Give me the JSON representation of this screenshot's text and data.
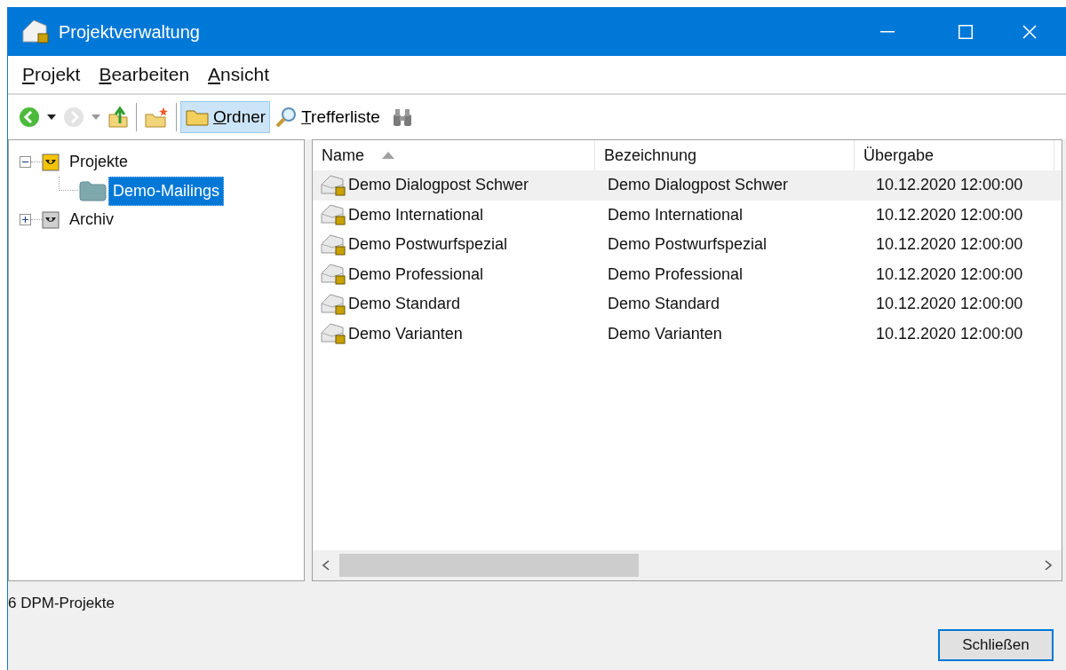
{
  "window": {
    "title": "Projektverwaltung"
  },
  "menu": [
    {
      "label": "Projekt",
      "mnemonic": true
    },
    {
      "label": "Bearbeiten",
      "mnemonic": true
    },
    {
      "label": "Ansicht",
      "mnemonic": true
    }
  ],
  "toolbar": [
    {
      "kind": "back",
      "disabled": false
    },
    {
      "kind": "back-dropdown",
      "disabled": false
    },
    {
      "kind": "forward",
      "disabled": true
    },
    {
      "kind": "forward-dropdown",
      "disabled": true
    },
    {
      "kind": "up",
      "disabled": false
    },
    {
      "kind": "separator"
    },
    {
      "kind": "new-folder",
      "disabled": false
    },
    {
      "kind": "separator"
    },
    {
      "kind": "folders",
      "label": "Ordner",
      "mnemonic": true,
      "selected": true
    },
    {
      "kind": "results",
      "label": "Trefferliste",
      "mnemonic": true,
      "selected": false
    },
    {
      "kind": "find",
      "disabled": false
    }
  ],
  "tree": [
    {
      "label": "Projekte",
      "expanded": true,
      "selected": false,
      "active": true,
      "children": [
        {
          "label": "Demo-Mailings",
          "selected": true
        }
      ]
    },
    {
      "label": "Archiv",
      "expanded": false,
      "selected": false,
      "active": false
    }
  ],
  "table": {
    "columns": [
      {
        "label": "Name",
        "sorted": true
      },
      {
        "label": "Bezeichnung"
      },
      {
        "label": "Übergabe"
      }
    ],
    "rows": [
      {
        "cells": [
          "Demo Dialogpost Schwer",
          "Demo Dialogpost Schwer",
          "10.12.2020 12:00:00"
        ],
        "selected": true
      },
      {
        "cells": [
          "Demo International",
          "Demo International",
          "10.12.2020 12:00:00"
        ],
        "selected": false
      },
      {
        "cells": [
          "Demo Postwurfspezial",
          "Demo Postwurfspezial",
          "10.12.2020 12:00:00"
        ],
        "selected": false
      },
      {
        "cells": [
          "Demo Professional",
          "Demo Professional",
          "10.12.2020 12:00:00"
        ],
        "selected": false
      },
      {
        "cells": [
          "Demo Standard",
          "Demo Standard",
          "10.12.2020 12:00:00"
        ],
        "selected": false
      },
      {
        "cells": [
          "Demo Varianten",
          "Demo Varianten",
          "10.12.2020 12:00:00"
        ],
        "selected": false
      }
    ]
  },
  "status_bar": "6 DPM-Projekte",
  "buttons": [
    {
      "label": "Schließen",
      "default": true
    }
  ]
}
